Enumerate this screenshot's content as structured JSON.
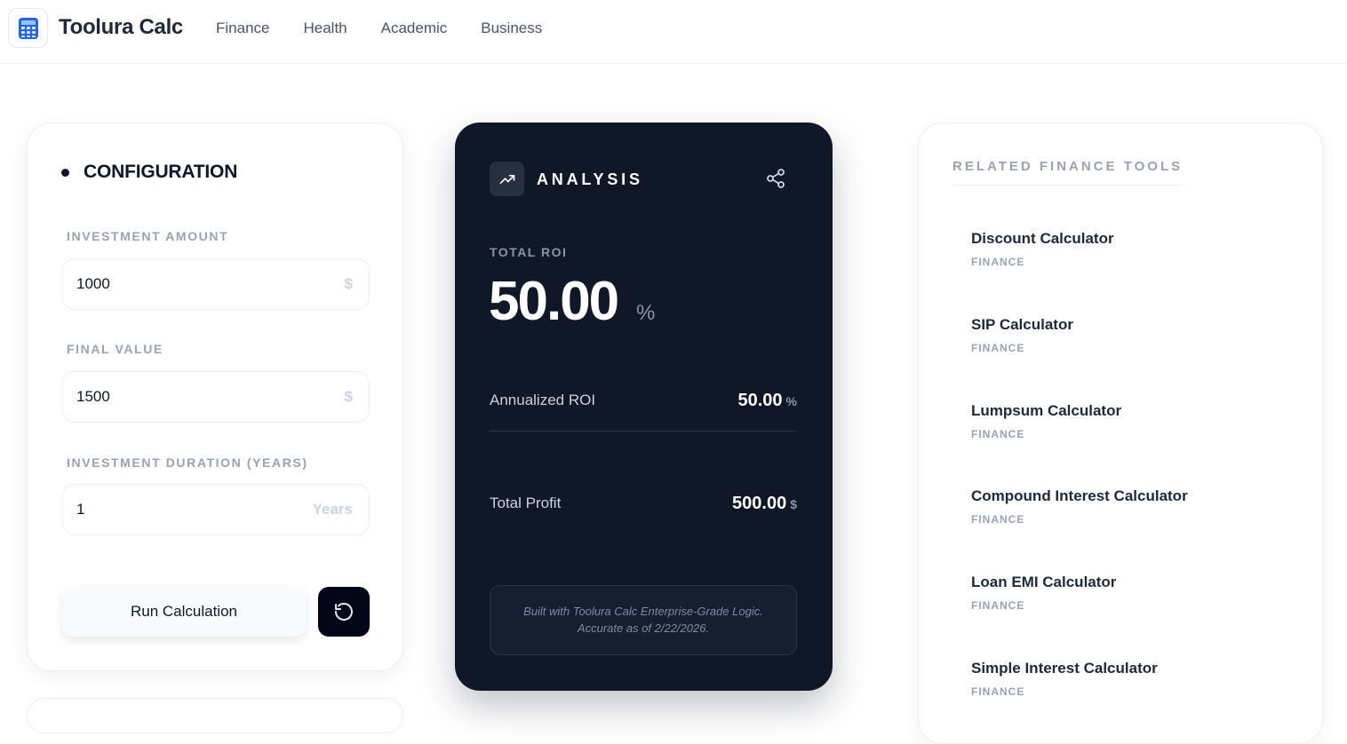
{
  "header": {
    "brand": "Toolura Calc",
    "nav": [
      "Finance",
      "Health",
      "Academic",
      "Business"
    ]
  },
  "config": {
    "title": "CONFIGURATION",
    "fields": [
      {
        "label": "INVESTMENT AMOUNT",
        "value": "1000",
        "unit": "$"
      },
      {
        "label": "FINAL VALUE",
        "value": "1500",
        "unit": "$"
      },
      {
        "label": "INVESTMENT DURATION (YEARS)",
        "value": "1",
        "unit": "Years"
      }
    ],
    "run_label": "Run Calculation"
  },
  "analysis": {
    "title": "ANALYSIS",
    "total_roi_label": "TOTAL ROI",
    "total_roi_value": "50.00",
    "total_roi_unit": "%",
    "rows": [
      {
        "label": "Annualized ROI",
        "value": "50.00",
        "unit": "%"
      },
      {
        "label": "Total Profit",
        "value": "500.00",
        "unit": "$"
      }
    ],
    "note_line1": "Built with Toolura Calc Enterprise-Grade Logic.",
    "note_line2": "Accurate as of 2/22/2026."
  },
  "related": {
    "title": "RELATED FINANCE TOOLS",
    "tools": [
      {
        "name": "Discount Calculator",
        "category": "FINANCE"
      },
      {
        "name": "SIP Calculator",
        "category": "FINANCE"
      },
      {
        "name": "Lumpsum Calculator",
        "category": "FINANCE"
      },
      {
        "name": "Compound Interest Calculator",
        "category": "FINANCE"
      },
      {
        "name": "Loan EMI Calculator",
        "category": "FINANCE"
      },
      {
        "name": "Simple Interest Calculator",
        "category": "FINANCE"
      }
    ]
  },
  "icons": {
    "logo": "calculator-icon",
    "analysis": "trending-up-icon",
    "share": "share-icon",
    "reset": "rotate-ccw-icon"
  },
  "colors": {
    "dark_card": "#101828",
    "reset_button": "#020617",
    "muted_label": "#9aa3b2"
  }
}
